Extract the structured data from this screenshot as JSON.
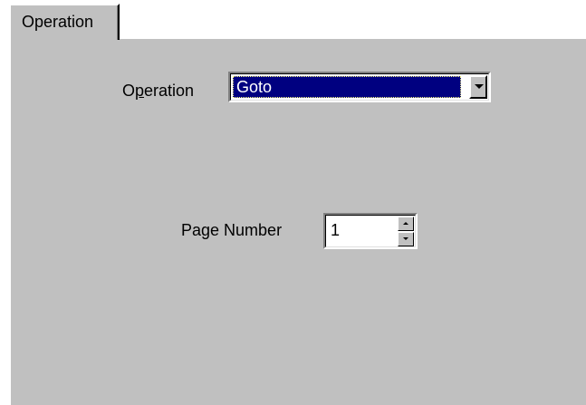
{
  "tab": {
    "label": "Operation"
  },
  "operation": {
    "label_pre": "O",
    "label_underlined": "p",
    "label_post": "eration",
    "selected_value": "Goto"
  },
  "page_number": {
    "label": "Page Number",
    "value": "1"
  },
  "colors": {
    "panel_bg": "#c0c0c0",
    "selection_bg": "#000080",
    "selection_text": "#ffffff"
  }
}
